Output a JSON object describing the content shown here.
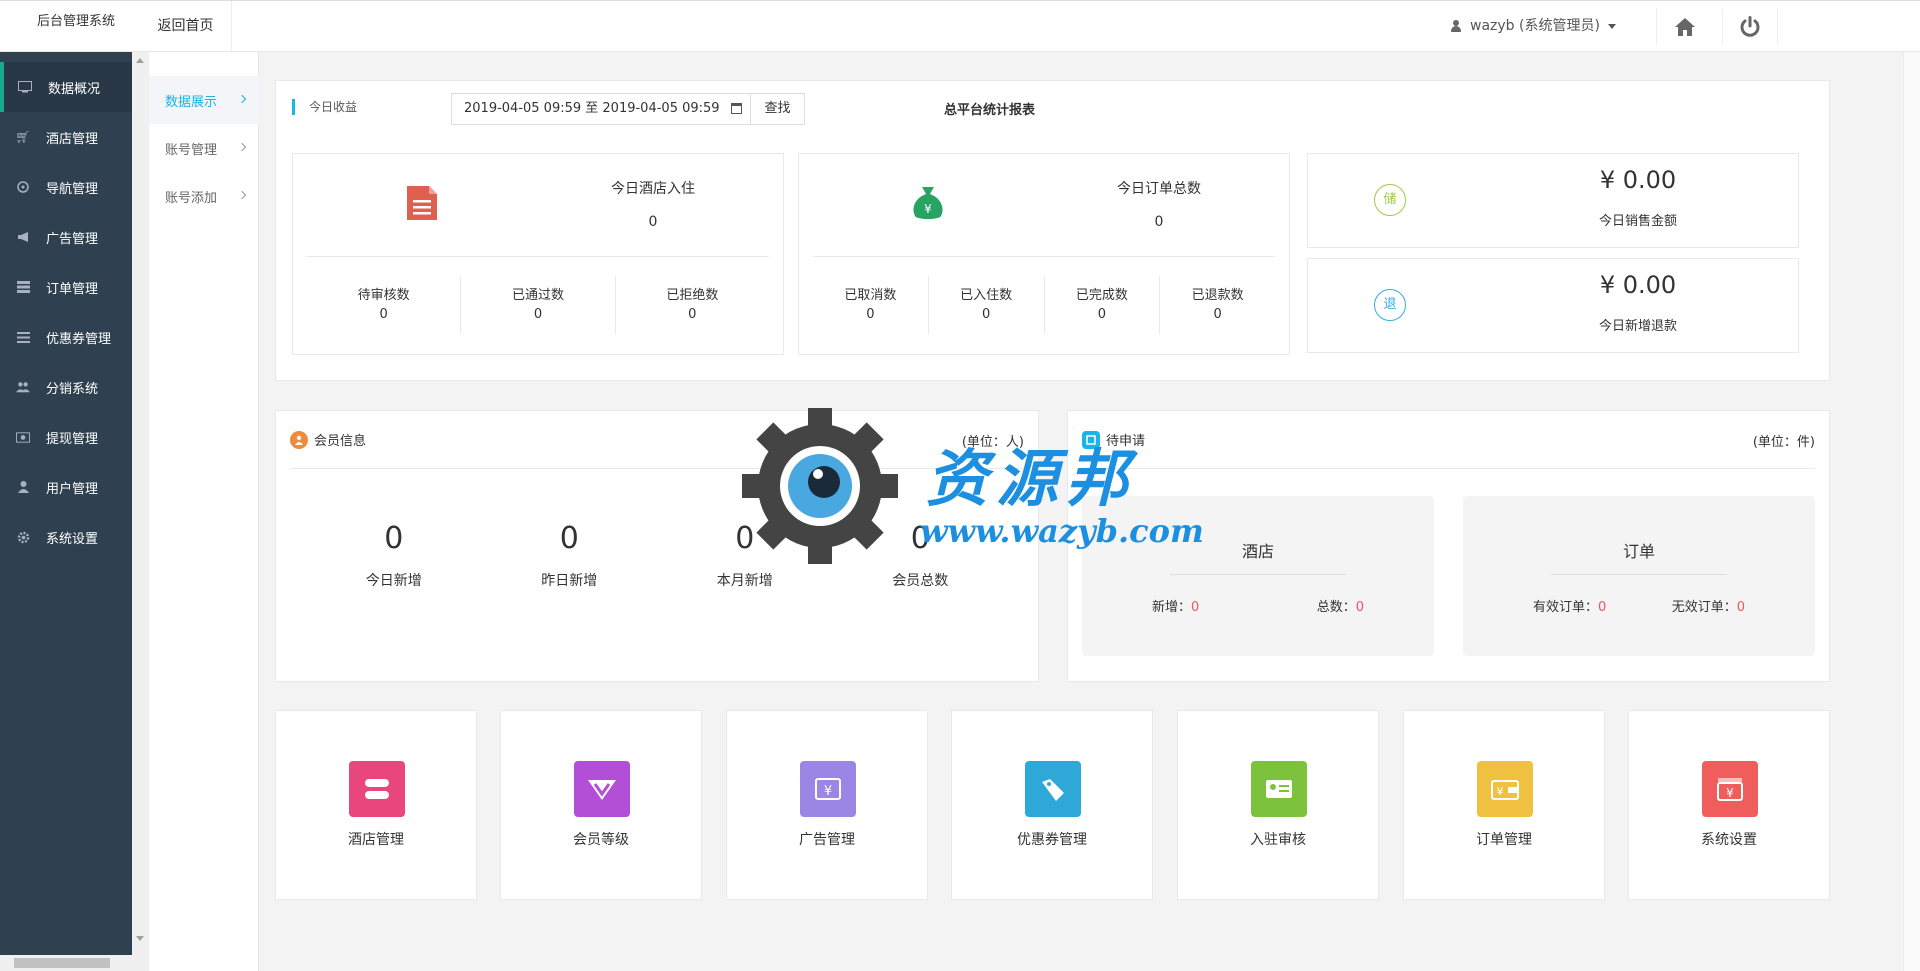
{
  "header": {
    "brand": "后台管理系统",
    "back_home": "返回首页",
    "user": "wazyb (系统管理员)"
  },
  "sidebar": {
    "items": [
      {
        "label": "数据概况",
        "icon": "monitor-icon"
      },
      {
        "label": "酒店管理",
        "icon": "cart-icon"
      },
      {
        "label": "导航管理",
        "icon": "compass-icon"
      },
      {
        "label": "广告管理",
        "icon": "bullhorn-icon"
      },
      {
        "label": "订单管理",
        "icon": "list-icon"
      },
      {
        "label": "优惠券管理",
        "icon": "bars-icon"
      },
      {
        "label": "分销系统",
        "icon": "users-icon"
      },
      {
        "label": "提现管理",
        "icon": "money-icon"
      },
      {
        "label": "用户管理",
        "icon": "user-icon"
      },
      {
        "label": "系统设置",
        "icon": "gear-icon"
      }
    ]
  },
  "subnav": {
    "items": [
      {
        "label": "数据展示"
      },
      {
        "label": "账号管理"
      },
      {
        "label": "账号添加"
      }
    ]
  },
  "revenue": {
    "title": "今日收益",
    "date_range": "2019-04-05 09:59 至 2019-04-05 09:59",
    "search_label": "查找",
    "report_title": "总平台统计报表",
    "hotel": {
      "label": "今日酒店入住",
      "value": "0",
      "sub": [
        {
          "label": "待审核数",
          "value": "0"
        },
        {
          "label": "已通过数",
          "value": "0"
        },
        {
          "label": "已拒绝数",
          "value": "0"
        }
      ]
    },
    "orders": {
      "label": "今日订单总数",
      "value": "0",
      "sub": [
        {
          "label": "已取消数",
          "value": "0"
        },
        {
          "label": "已入住数",
          "value": "0"
        },
        {
          "label": "已完成数",
          "value": "0"
        },
        {
          "label": "已退款数",
          "value": "0"
        }
      ]
    },
    "sales": {
      "badge": "储",
      "amount": "¥ 0.00",
      "label": "今日销售金额",
      "color": "#a0c84a"
    },
    "refund": {
      "badge": "退",
      "amount": "¥ 0.00",
      "label": "今日新增退款",
      "color": "#3aa8e8"
    }
  },
  "member": {
    "title": "会员信息",
    "unit": "(单位：人)",
    "stats": [
      {
        "value": "0",
        "label": "今日新增"
      },
      {
        "value": "0",
        "label": "昨日新增"
      },
      {
        "value": "0",
        "label": "本月新增"
      },
      {
        "value": "0",
        "label": "会员总数"
      }
    ]
  },
  "apply": {
    "title": "待申请",
    "unit": "(单位：件)",
    "hotel": {
      "title": "酒店",
      "left_label": "新增：",
      "left_value": "0",
      "right_label": "总数：",
      "right_value": "0"
    },
    "order": {
      "title": "订单",
      "left_label": "有效订单：",
      "left_value": "0",
      "right_label": "无效订单：",
      "right_value": "0"
    }
  },
  "tiles": [
    {
      "label": "酒店管理",
      "color": "#e8467c"
    },
    {
      "label": "会员等级",
      "color": "#b34ed6"
    },
    {
      "label": "广告管理",
      "color": "#9b86e6"
    },
    {
      "label": "优惠券管理",
      "color": "#2ea8d8"
    },
    {
      "label": "入驻审核",
      "color": "#7cc23c"
    },
    {
      "label": "订单管理",
      "color": "#f0c040"
    },
    {
      "label": "系统设置",
      "color": "#f05d5d"
    }
  ],
  "watermark": {
    "text": "资源邦",
    "url": "www.wazyb.com"
  }
}
